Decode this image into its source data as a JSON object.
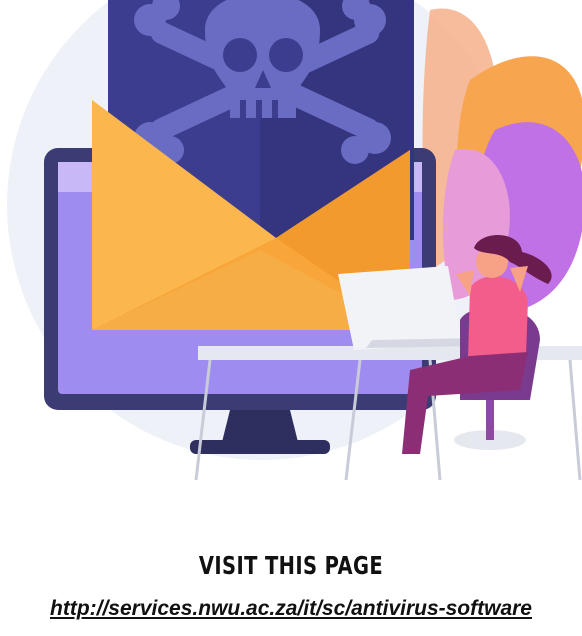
{
  "heading": "VISIT THIS PAGE",
  "link": {
    "text": "http://services.nwu.ac.za/it/sc/antivirus-software",
    "href": "http://services.nwu.ac.za/it/sc/antivirus-software"
  },
  "colors": {
    "heading": "#111111",
    "link": "#111111",
    "background": "#ffffff",
    "circle": "#eef1f7",
    "envelope_flag": "#3c3d8e",
    "envelope_body": "#f8a63a",
    "monitor_frame": "#3b3c73",
    "monitor_screen": "#9f8cf0",
    "leaf_orange": "#f7a54f",
    "leaf_purple": "#c071e6"
  },
  "icons": [
    "skull-crossbones-icon"
  ]
}
